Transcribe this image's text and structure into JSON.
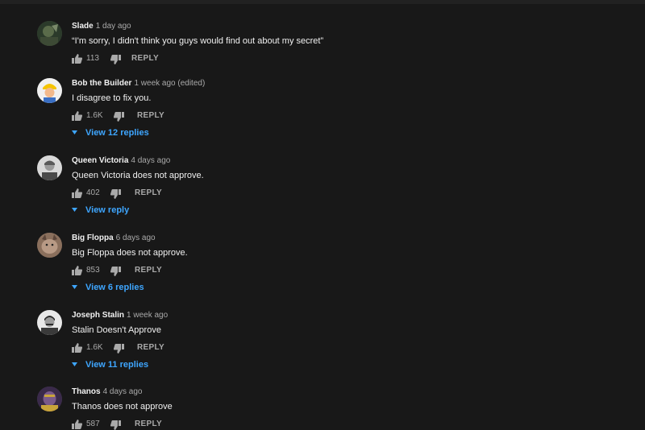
{
  "comments": [
    {
      "author": "Slade",
      "time": "1 day ago",
      "text": "“I'm sorry, I didn't think you guys would find out about my secret”",
      "likes": "113",
      "reply_label": "REPLY",
      "view_replies": ""
    },
    {
      "author": "Bob the Builder",
      "time": "1 week ago (edited)",
      "text": "I disagree to fix you.",
      "likes": "1.6K",
      "reply_label": "REPLY",
      "view_replies": "View 12 replies"
    },
    {
      "author": "Queen Victoria",
      "time": "4 days ago",
      "text": "Queen Victoria does not approve.",
      "likes": "402",
      "reply_label": "REPLY",
      "view_replies": "View reply"
    },
    {
      "author": "Big Floppa",
      "time": "6 days ago",
      "text": "Big Floppa does not approve.",
      "likes": "853",
      "reply_label": "REPLY",
      "view_replies": "View 6 replies"
    },
    {
      "author": "Joseph Stalin",
      "time": "1 week ago",
      "text": "Stalin Doesn't Approve",
      "likes": "1.6K",
      "reply_label": "REPLY",
      "view_replies": "View 11 replies"
    },
    {
      "author": "Thanos",
      "time": "4 days ago",
      "text": "Thanos does not approve",
      "likes": "587",
      "reply_label": "REPLY",
      "view_replies": ""
    }
  ],
  "colors": {
    "background": "#181818",
    "link": "#3ea6ff",
    "secondary_text": "#aaaaaa"
  },
  "icons": {
    "like": "thumbs-up-icon",
    "dislike": "thumbs-down-icon",
    "expand": "caret-down-icon"
  }
}
